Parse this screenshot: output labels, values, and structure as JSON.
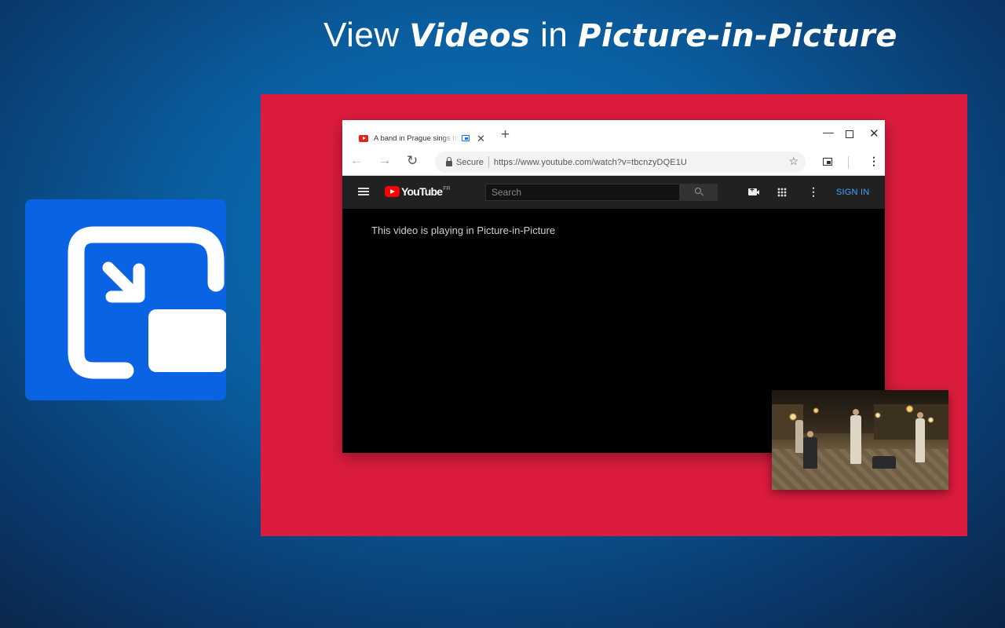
{
  "headline": {
    "prefix": "View ",
    "bold1": "Videos",
    "middle": " in ",
    "bold2": "Picture-in-Picture"
  },
  "browser": {
    "tab": {
      "title": "A band in Prague sings the",
      "close": "✕"
    },
    "new_tab": "+",
    "window_controls": {
      "minimize": "—",
      "close": "✕"
    },
    "nav": {
      "back": "←",
      "forward": "→",
      "reload": "↻"
    },
    "omnibox": {
      "secure_label": "Secure",
      "url": "https://www.youtube.com/watch?v=tbcnzyDQE1U",
      "star": "☆"
    },
    "menu": "⋮"
  },
  "youtube": {
    "logo": "YouTube",
    "region": "FR",
    "search_placeholder": "Search",
    "more": "⋮",
    "sign_in": "SIGN IN",
    "pip_message": "This video is playing in Picture-in-Picture"
  },
  "colors": {
    "stage": "#dc1c3e",
    "icon_tile": "#0a63e2",
    "youtube_red": "#ff0000",
    "sign_in_blue": "#3ea6ff"
  },
  "icons": {
    "app_icon": "picture-in-picture-icon",
    "tab_favicon": "youtube-favicon-icon",
    "tab_pip": "pip-indicator-icon",
    "lock": "lock-icon",
    "pip_extension": "pip-extension-icon",
    "upload": "video-upload-icon",
    "apps": "apps-grid-icon",
    "search": "search-icon",
    "hamburger": "hamburger-menu-icon"
  }
}
